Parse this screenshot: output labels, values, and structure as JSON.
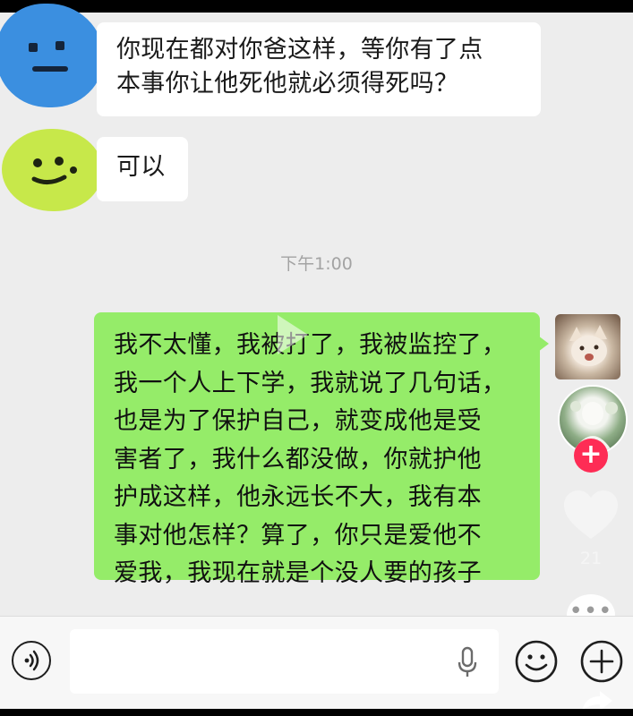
{
  "messages": [
    {
      "side": "left",
      "avatar": "blue-face-avatar",
      "text": "你现在都对你爸这样，等你有了点本事你让他死他就必须得死吗？",
      "lines": [
        "你现在都对你爸这样，等你有了点",
        "本事你让他死他就必须得死吗？"
      ]
    },
    {
      "side": "left",
      "avatar": "green-face-avatar",
      "text": "可以",
      "lines": [
        "可以"
      ]
    }
  ],
  "timestamp": "下午1:00",
  "reply": {
    "side": "right",
    "lines": [
      "我不太懂，我被打了，我被监控了，",
      "我一个人上下学，我就说了几句话，",
      "也是为了保护自己，就变成他是受",
      "害者了，我什么都没做，你就护他",
      "护成这样，他永远长不大，我有本",
      "事对他怎样？算了，你只是爱他不",
      "爱我，我现在就是个没人要的孩子"
    ]
  },
  "overlay": {
    "like_count": "21",
    "follow_label": "+",
    "comment_label": "•••"
  },
  "colors": {
    "chat_bg": "#ededed",
    "incoming_bubble": "#ffffff",
    "outgoing_bubble": "#95ec69",
    "follow_red": "#fe2c55",
    "blue_blob": "#3b8fe0",
    "green_blob": "#c7e84a"
  },
  "icons": [
    "voice-icon",
    "microphone-icon",
    "emoji-icon",
    "plus-icon",
    "heart-icon",
    "share-arrow-icon",
    "play-icon"
  ]
}
